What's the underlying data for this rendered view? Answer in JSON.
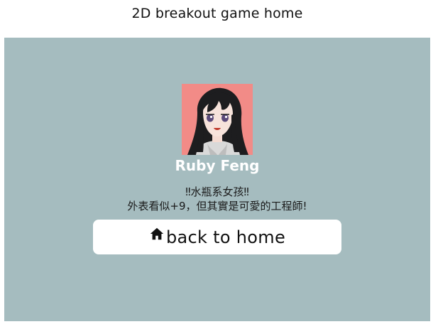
{
  "header": {
    "title": "2D breakout game home"
  },
  "colors": {
    "panel_background": "#a5bcbf",
    "avatar_background": "#f28b87",
    "button_background": "#ffffff",
    "name_color": "#ffffff"
  },
  "profile": {
    "name": "Ruby Feng",
    "bio_line1": "‼水瓶系女孩‼",
    "bio_line2": "外表看似+9，但其實是可愛的工程師!"
  },
  "actions": {
    "home_button_label": "back to home",
    "home_button_icon": "home-icon"
  }
}
